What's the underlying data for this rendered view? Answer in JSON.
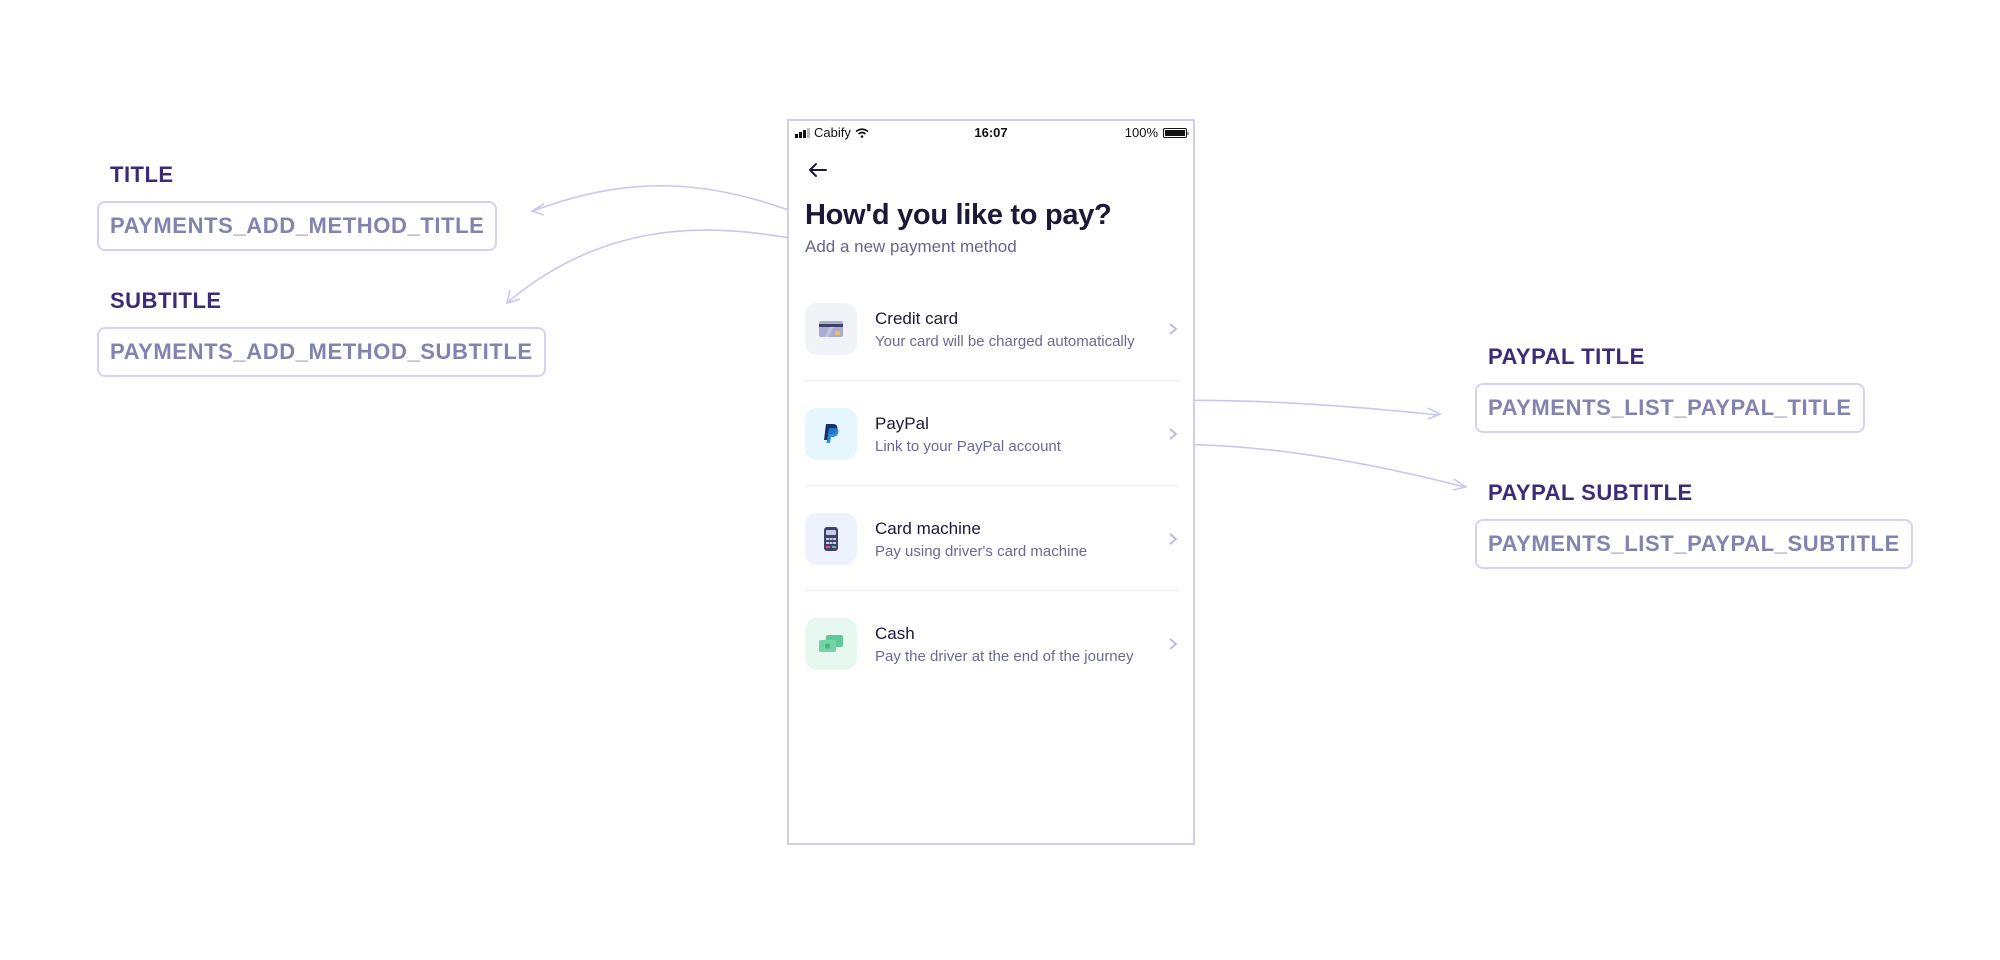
{
  "annotations": {
    "title": {
      "label": "TITLE",
      "key": "PAYMENTS_ADD_METHOD_TITLE"
    },
    "subtitle": {
      "label": "SUBTITLE",
      "key": "PAYMENTS_ADD_METHOD_SUBTITLE"
    },
    "paypal_title": {
      "label": "PAYPAL TITLE",
      "key": "PAYMENTS_LIST_PAYPAL_TITLE"
    },
    "paypal_subtitle": {
      "label": "PAYPAL SUBTITLE",
      "key": "PAYMENTS_LIST_PAYPAL_SUBTITLE"
    }
  },
  "status_bar": {
    "carrier": "Cabify",
    "time": "16:07",
    "battery": "100%"
  },
  "screen": {
    "title": "How'd you like to pay?",
    "subtitle": "Add a new payment method",
    "methods": [
      {
        "title": "Credit card",
        "subtitle": "Your card will be charged automatically",
        "icon": "credit-card-icon"
      },
      {
        "title": "PayPal",
        "subtitle": "Link to your PayPal account",
        "icon": "paypal-icon"
      },
      {
        "title": "Card machine",
        "subtitle": "Pay using driver's card machine",
        "icon": "card-machine-icon"
      },
      {
        "title": "Cash",
        "subtitle": "Pay the driver at the end of the journey",
        "icon": "cash-icon"
      }
    ]
  },
  "colors": {
    "label": "#3d2a78",
    "key_text": "#8383b2",
    "key_border": "#d3d3ef",
    "connector": "#c8c8ee",
    "title_text": "#1a1a38"
  }
}
